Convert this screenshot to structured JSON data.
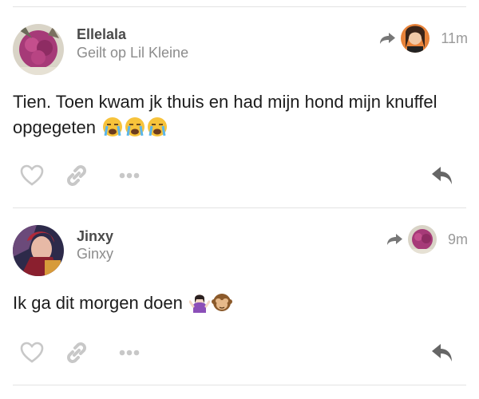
{
  "posts": [
    {
      "author": "Ellelala",
      "subline": "Geilt op Lil Kleine",
      "time": "11m",
      "text": "Tien. Toen kwam jk thuis en had mijn hond mijn knuffel opgegeten",
      "emojis": [
        "crying-face",
        "crying-face",
        "crying-face"
      ],
      "avatar_color": "#a63a78"
    },
    {
      "author": "Jinxy",
      "subline": "Ginxy",
      "time": "9m",
      "text": "Ik ga dit morgen doen",
      "emojis": [
        "person-shrugging",
        "see-no-evil-monkey"
      ],
      "avatar_color": "#7a3a4a"
    }
  ],
  "colors": {
    "icon": "#c8c8c8",
    "reply": "#666666",
    "divider": "#e3e3e3"
  }
}
